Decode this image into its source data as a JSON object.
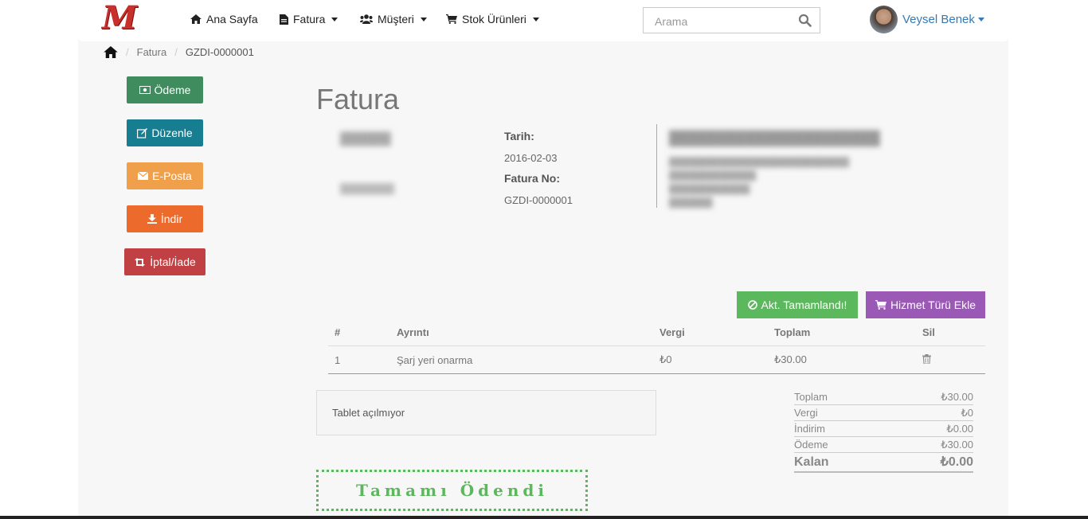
{
  "nav": {
    "items": [
      {
        "label": "Ana Sayfa",
        "icon": "home-icon"
      },
      {
        "label": "Fatura",
        "icon": "file-icon"
      },
      {
        "label": "Müşteri",
        "icon": "users-icon"
      },
      {
        "label": "Stok Ürünleri",
        "icon": "cart-icon"
      }
    ],
    "search_placeholder": "Arama",
    "user_name": "Veysel Benek"
  },
  "breadcrumb": {
    "parent": "Fatura",
    "current": "GZDI-0000001"
  },
  "side_buttons": [
    {
      "label": "Ödeme",
      "color": "#3f8c5f",
      "icon": "money-icon"
    },
    {
      "label": "Düzenle",
      "color": "#177d91",
      "icon": "edit-icon"
    },
    {
      "label": "E-Posta",
      "color": "#f0a04a",
      "icon": "envelope-icon"
    },
    {
      "label": "İndir",
      "color": "#ec6a2c",
      "icon": "download-icon"
    },
    {
      "label": "İptal/İade",
      "color": "#c14043",
      "icon": "retweet-icon"
    }
  ],
  "invoice": {
    "title": "Fatura",
    "date_label": "Tarih:",
    "date": "2016-02-03",
    "number_label": "Fatura No:",
    "number": "GZDI-0000001"
  },
  "actions": {
    "complete_label": "Akt. Tamamlandı!",
    "complete_color": "#5cb85c",
    "add_service_label": "Hizmet Türü Ekle",
    "add_service_color": "#9b59b6"
  },
  "items_table": {
    "headers": [
      "#",
      "Ayrıntı",
      "Vergi",
      "Toplam",
      "Sil"
    ],
    "rows": [
      {
        "no": "1",
        "detail": "Şarj yeri onarma",
        "tax": "₺0",
        "total": "₺30.00"
      }
    ]
  },
  "note": "Tablet açılmıyor",
  "totals": [
    {
      "label": "Toplam",
      "value": "₺30.00"
    },
    {
      "label": "Vergi",
      "value": "₺0"
    },
    {
      "label": "İndirim",
      "value": "₺0.00"
    },
    {
      "label": "Ödeme",
      "value": "₺30.00"
    },
    {
      "label": "Kalan",
      "value": "₺0.00"
    }
  ],
  "stamp": "Tamamı Ödendi"
}
